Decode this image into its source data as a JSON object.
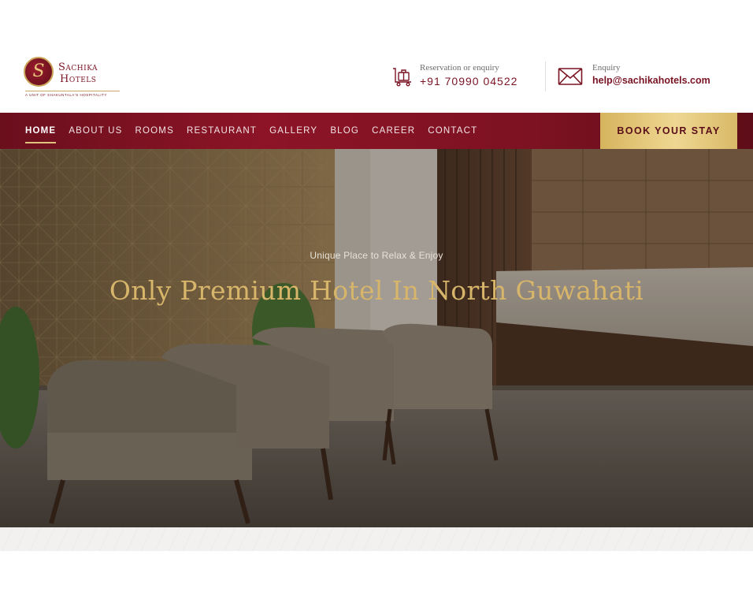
{
  "brand": {
    "emblem": "S",
    "name_line1": "Sachika",
    "name_line2": "Hotels",
    "tagline": "A UNIT OF SHAKUNTALA'S HOSPITALITY"
  },
  "contact": {
    "phone_label": "Reservation or enquiry",
    "phone_value": "+91 70990 04522",
    "email_label": "Enquiry",
    "email_value": "help@sachikahotels.com"
  },
  "nav": {
    "items": [
      {
        "label": "HOME"
      },
      {
        "label": "ABOUT US"
      },
      {
        "label": "ROOMS"
      },
      {
        "label": "RESTAURANT"
      },
      {
        "label": "GALLERY"
      },
      {
        "label": "BLOG"
      },
      {
        "label": "CAREER"
      },
      {
        "label": "CONTACT"
      }
    ],
    "active": "HOME",
    "cta": "BOOK YOUR STAY"
  },
  "hero": {
    "subtitle": "Unique Place to Relax & Enjoy",
    "title": "Only Premium Hotel In North Guwahati"
  },
  "colors": {
    "brand_maroon": "#7a1424",
    "gold_accent": "#d7b56a",
    "nav_bg": "#8c1426"
  },
  "icons": {
    "phone": "luggage-cart-icon",
    "email": "envelope-icon"
  }
}
